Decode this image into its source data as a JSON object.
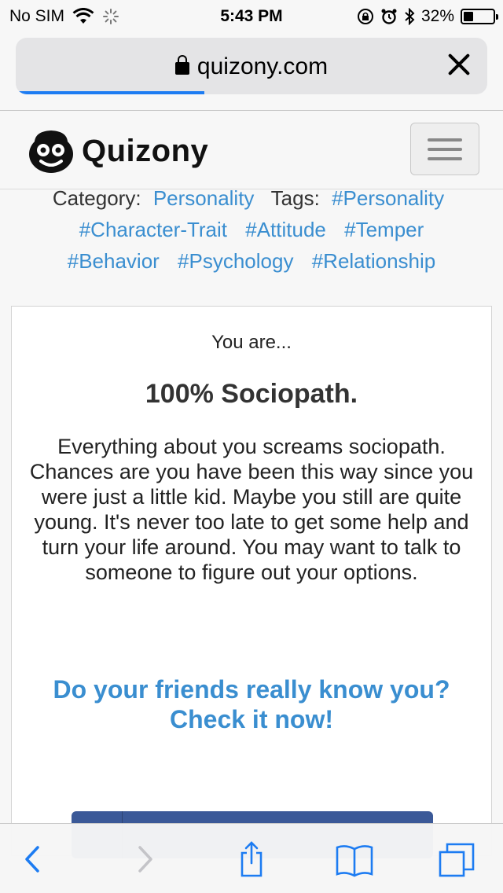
{
  "status_bar": {
    "carrier": "No SIM",
    "time": "5:43 PM",
    "battery_percent": "32%",
    "battery_level": 0.32
  },
  "url_bar": {
    "domain": "quizony.com",
    "load_progress": 0.4
  },
  "site": {
    "logo_text": "Quizony"
  },
  "quiz_meta": {
    "category_label": "Category:",
    "category": "Personality",
    "tags_label": "Tags:",
    "tags": [
      "#Personality",
      "#Character-Trait",
      "#Attitude",
      "#Temper",
      "#Behavior",
      "#Psychology",
      "#Relationship"
    ]
  },
  "result": {
    "intro": "You are...",
    "title": "100% Sociopath.",
    "description": "Everything about you screams sociopath. Chances are you have been this way since you were just a little kid. Maybe you still are quite young. It's never too late to get some help and turn your life around. You may want to talk to someone to figure out your options.",
    "cta_line1": "Do your friends really know you?",
    "cta_line2": "Check it now!"
  },
  "colors": {
    "link": "#3a8ed0",
    "progress": "#1d7cf2",
    "facebook": "#3b5998",
    "toolbar_icon": "#1d7cf2"
  },
  "icons": {
    "status": [
      "wifi-icon",
      "loading-spinner-icon",
      "orientation-lock-icon",
      "alarm-icon",
      "bluetooth-icon",
      "battery-icon"
    ],
    "toolbar": [
      "back-icon",
      "forward-icon",
      "share-icon",
      "bookmarks-icon",
      "tabs-icon"
    ]
  }
}
